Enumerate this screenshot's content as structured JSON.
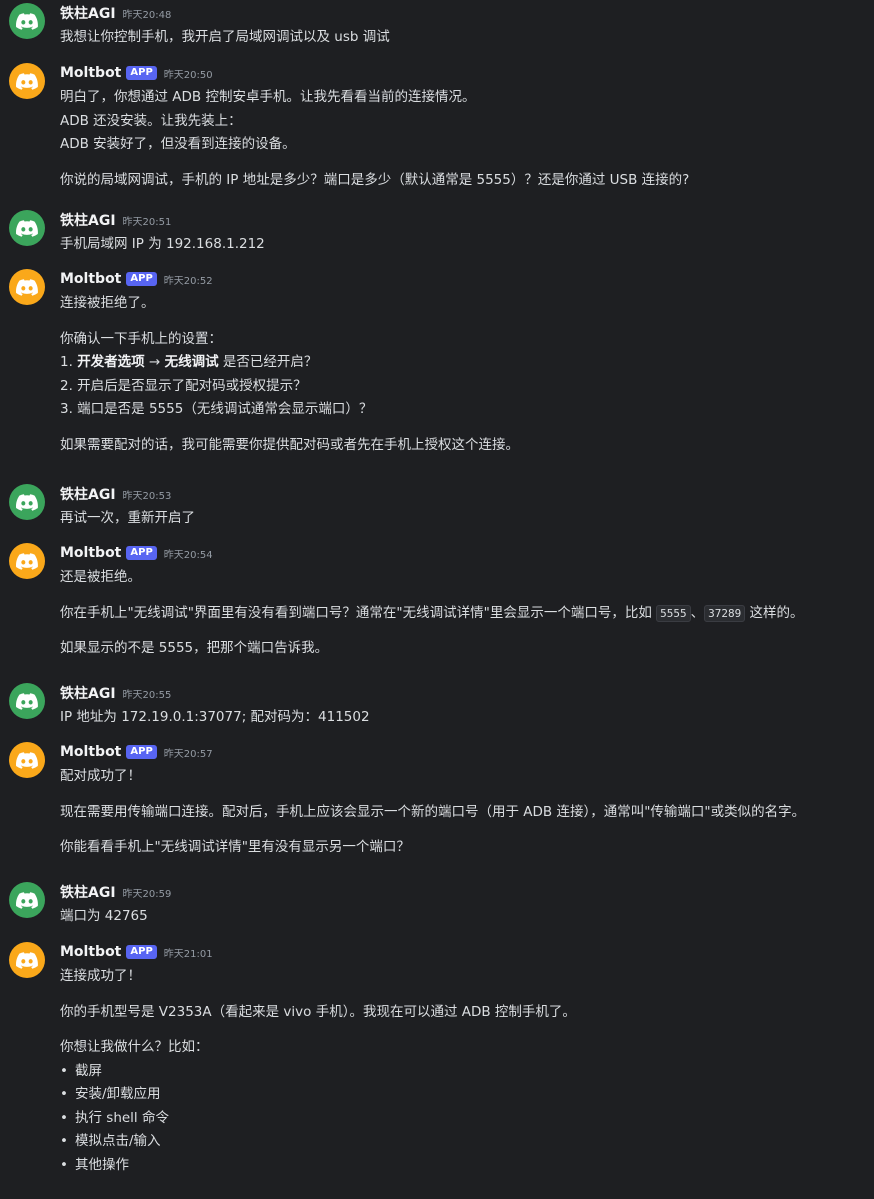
{
  "colors": {
    "background": "#1e1f22",
    "avatar_user": "#3ba55c",
    "avatar_bot": "#faa81a",
    "app_badge": "#5865f2",
    "text": "#dbdee1",
    "timestamp": "#949ba4"
  },
  "icons": {
    "avatar": "discord-logo-icon"
  },
  "messages": [
    {
      "author": "铁柱AGI",
      "timestamp": "昨天20:48",
      "line1": "我想让你控制手机，我开启了局域网调试以及 usb 调试"
    },
    {
      "author": "Moltbot",
      "badge": "APP",
      "timestamp": "昨天20:50",
      "line1": "明白了，你想通过 ADB 控制安卓手机。让我先看看当前的连接情况。",
      "line2": "ADB 还没安装。让我先装上：",
      "line3": "ADB 安装好了，但没看到连接的设备。",
      "line4": "你说的局域网调试，手机的 IP 地址是多少？端口是多少（默认通常是 5555）？还是你通过 USB 连接的?"
    },
    {
      "author": "铁柱AGI",
      "timestamp": "昨天20:51",
      "line1": "手机局域网 IP 为 192.168.1.212"
    },
    {
      "author": "Moltbot",
      "badge": "APP",
      "timestamp": "昨天20:52",
      "line1": "连接被拒绝了。",
      "line2": "你确认一下手机上的设置：",
      "item1_num": "1.",
      "item1_bold1": "开发者选项",
      "item1_arrow": " → ",
      "item1_bold2": "无线调试",
      "item1_rest": " 是否已经开启？",
      "item2": "2. 开启后是否显示了配对码或授权提示？",
      "item3": "3. 端口是否是 5555（无线调试通常会显示端口）？",
      "line3": "如果需要配对的话，我可能需要你提供配对码或者先在手机上授权这个连接。"
    },
    {
      "author": "铁柱AGI",
      "timestamp": "昨天20:53",
      "line1": "再试一次，重新开启了"
    },
    {
      "author": "Moltbot",
      "badge": "APP",
      "timestamp": "昨天20:54",
      "line1": "还是被拒绝。",
      "line2_pre": "你在手机上\"无线调试\"界面里有没有看到端口号？通常在\"无线调试详情\"里会显示一个端口号，比如 ",
      "code1": "5555",
      "sep": "、",
      "code2": "37289",
      "line2_post": " 这样的。",
      "line3": "如果显示的不是 5555，把那个端口告诉我。"
    },
    {
      "author": "铁柱AGI",
      "timestamp": "昨天20:55",
      "line1": "IP 地址为 172.19.0.1:37077; 配对码为：411502"
    },
    {
      "author": "Moltbot",
      "badge": "APP",
      "timestamp": "昨天20:57",
      "line1": "配对成功了！",
      "line2": "现在需要用传输端口连接。配对后，手机上应该会显示一个新的端口号（用于 ADB 连接），通常叫\"传输端口\"或类似的名字。",
      "line3": "你能看看手机上\"无线调试详情\"里有没有显示另一个端口？"
    },
    {
      "author": "铁柱AGI",
      "timestamp": "昨天20:59",
      "line1": "端口为 42765"
    },
    {
      "author": "Moltbot",
      "badge": "APP",
      "timestamp": "昨天21:01",
      "line1": "连接成功了！",
      "line2": "你的手机型号是 V2353A（看起来是 vivo 手机）。我现在可以通过 ADB 控制手机了。",
      "line3": "你想让我做什么？比如：",
      "bullets": [
        "截屏",
        "安装/卸载应用",
        "执行 shell 命令",
        "模拟点击/输入",
        "其他操作"
      ]
    }
  ]
}
